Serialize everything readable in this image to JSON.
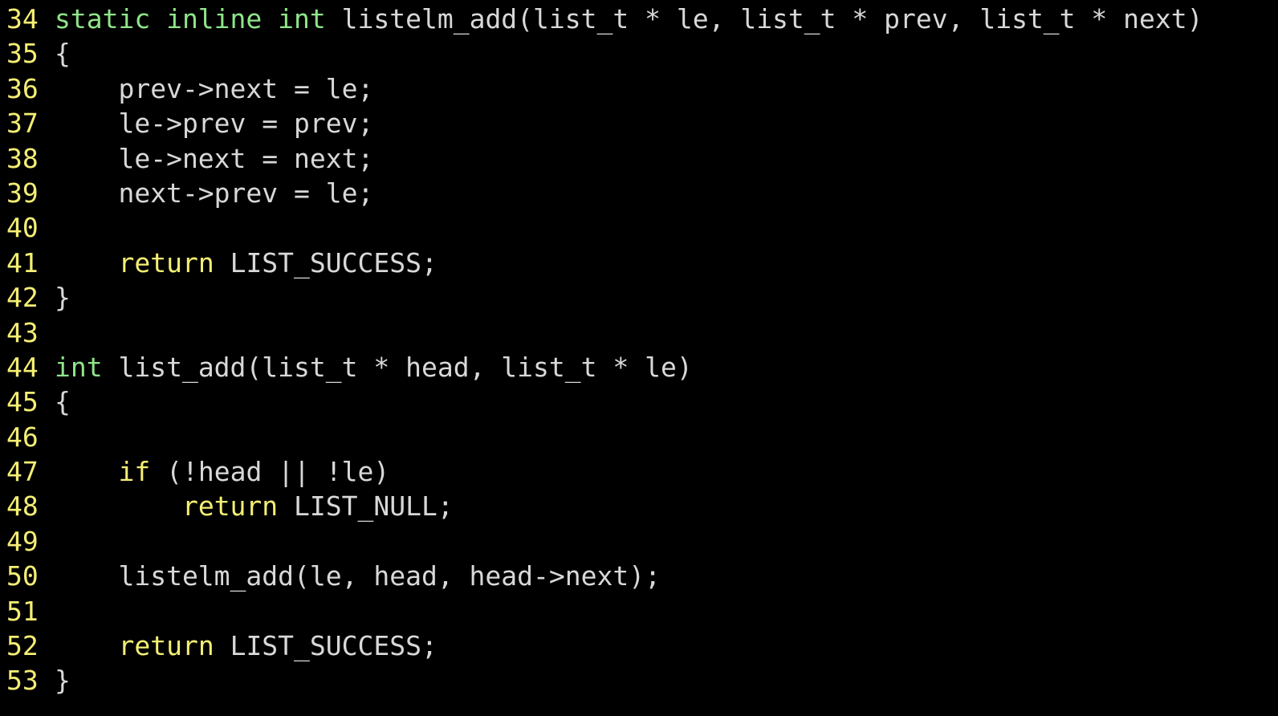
{
  "editor": {
    "colors": {
      "background": "#000000",
      "line_number": "#f4ee74",
      "storage_type": "#8fe58a",
      "keyword": "#f4ee74",
      "text": "#d8d8d8"
    },
    "lines": [
      {
        "number": "34",
        "tokens": [
          {
            "type": "storage",
            "text": "static inline int"
          },
          {
            "type": "plain",
            "text": " listelm_add(list_t * le, list_t * prev, list_t * next)"
          }
        ]
      },
      {
        "number": "35",
        "tokens": [
          {
            "type": "plain",
            "text": "{"
          }
        ]
      },
      {
        "number": "36",
        "tokens": [
          {
            "type": "plain",
            "text": "    prev->next = le;"
          }
        ]
      },
      {
        "number": "37",
        "tokens": [
          {
            "type": "plain",
            "text": "    le->prev = prev;"
          }
        ]
      },
      {
        "number": "38",
        "tokens": [
          {
            "type": "plain",
            "text": "    le->next = next;"
          }
        ]
      },
      {
        "number": "39",
        "tokens": [
          {
            "type": "plain",
            "text": "    next->prev = le;"
          }
        ]
      },
      {
        "number": "40",
        "tokens": []
      },
      {
        "number": "41",
        "tokens": [
          {
            "type": "plain",
            "text": "    "
          },
          {
            "type": "keyword",
            "text": "return"
          },
          {
            "type": "plain",
            "text": " LIST_SUCCESS;"
          }
        ]
      },
      {
        "number": "42",
        "tokens": [
          {
            "type": "plain",
            "text": "}"
          }
        ]
      },
      {
        "number": "43",
        "tokens": []
      },
      {
        "number": "44",
        "tokens": [
          {
            "type": "storage",
            "text": "int"
          },
          {
            "type": "plain",
            "text": " list_add(list_t * head, list_t * le)"
          }
        ]
      },
      {
        "number": "45",
        "tokens": [
          {
            "type": "plain",
            "text": "{"
          }
        ]
      },
      {
        "number": "46",
        "tokens": []
      },
      {
        "number": "47",
        "tokens": [
          {
            "type": "plain",
            "text": "    "
          },
          {
            "type": "keyword",
            "text": "if"
          },
          {
            "type": "plain",
            "text": " (!head || !le)"
          }
        ]
      },
      {
        "number": "48",
        "tokens": [
          {
            "type": "plain",
            "text": "        "
          },
          {
            "type": "keyword",
            "text": "return"
          },
          {
            "type": "plain",
            "text": " LIST_NULL;"
          }
        ]
      },
      {
        "number": "49",
        "tokens": []
      },
      {
        "number": "50",
        "tokens": [
          {
            "type": "plain",
            "text": "    listelm_add(le, head, head->next);"
          }
        ]
      },
      {
        "number": "51",
        "tokens": []
      },
      {
        "number": "52",
        "tokens": [
          {
            "type": "plain",
            "text": "    "
          },
          {
            "type": "keyword",
            "text": "return"
          },
          {
            "type": "plain",
            "text": " LIST_SUCCESS;"
          }
        ]
      },
      {
        "number": "53",
        "tokens": [
          {
            "type": "plain",
            "text": "}"
          }
        ]
      }
    ]
  }
}
